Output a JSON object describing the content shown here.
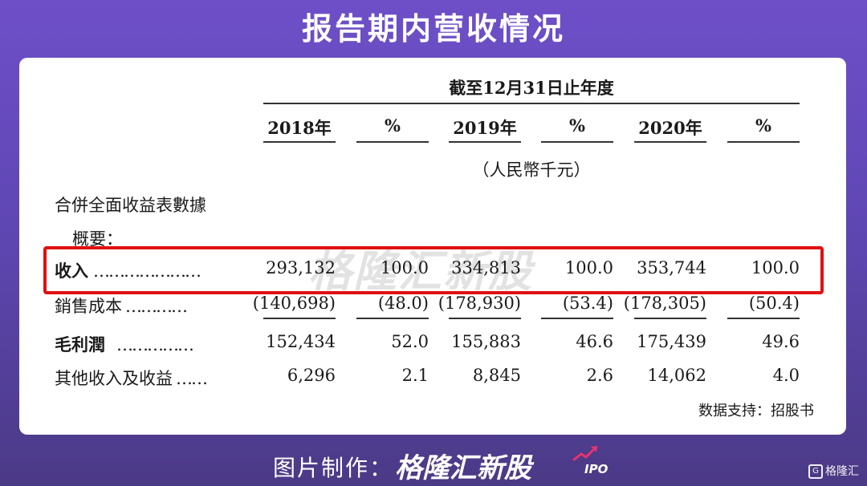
{
  "title": "报告期内营收情况",
  "table": {
    "period_header": "截至12月31日止年度",
    "columns": [
      "2018年",
      "%",
      "2019年",
      "%",
      "2020年",
      "%"
    ],
    "unit": "（人民幣千元）",
    "section_title": "合併全面收益表數據",
    "section_subtitle": "概要：",
    "rows": [
      {
        "label": "收入",
        "dots": "…………………",
        "values": [
          "293,132",
          "100.0",
          "334,813",
          "100.0",
          "353,744",
          "100.0"
        ]
      },
      {
        "label": "銷售成本",
        "dots": "…………",
        "values": [
          "(140,698)",
          "(48.0)",
          "(178,930)",
          "(53.4)",
          "(178,305)",
          "(50.4)"
        ]
      },
      {
        "label": "毛利潤",
        "dots": "……………",
        "values": [
          "152,434",
          "52.0",
          "155,883",
          "46.6",
          "175,439",
          "49.6"
        ]
      },
      {
        "label": "其他收入及收益",
        "dots": "……",
        "values": [
          "6,296",
          "2.1",
          "8,845",
          "2.6",
          "14,062",
          "4.0"
        ]
      }
    ]
  },
  "watermark": "格隆汇新股",
  "source": "数据支持：招股书",
  "footer": {
    "label": "图片制作：",
    "brand": "格隆汇新股",
    "ipo": "IPO"
  },
  "corner_logo": {
    "glyph": "G",
    "text": "格隆汇"
  },
  "colors": {
    "highlight": "#e01010",
    "accent": "#e8336f"
  }
}
